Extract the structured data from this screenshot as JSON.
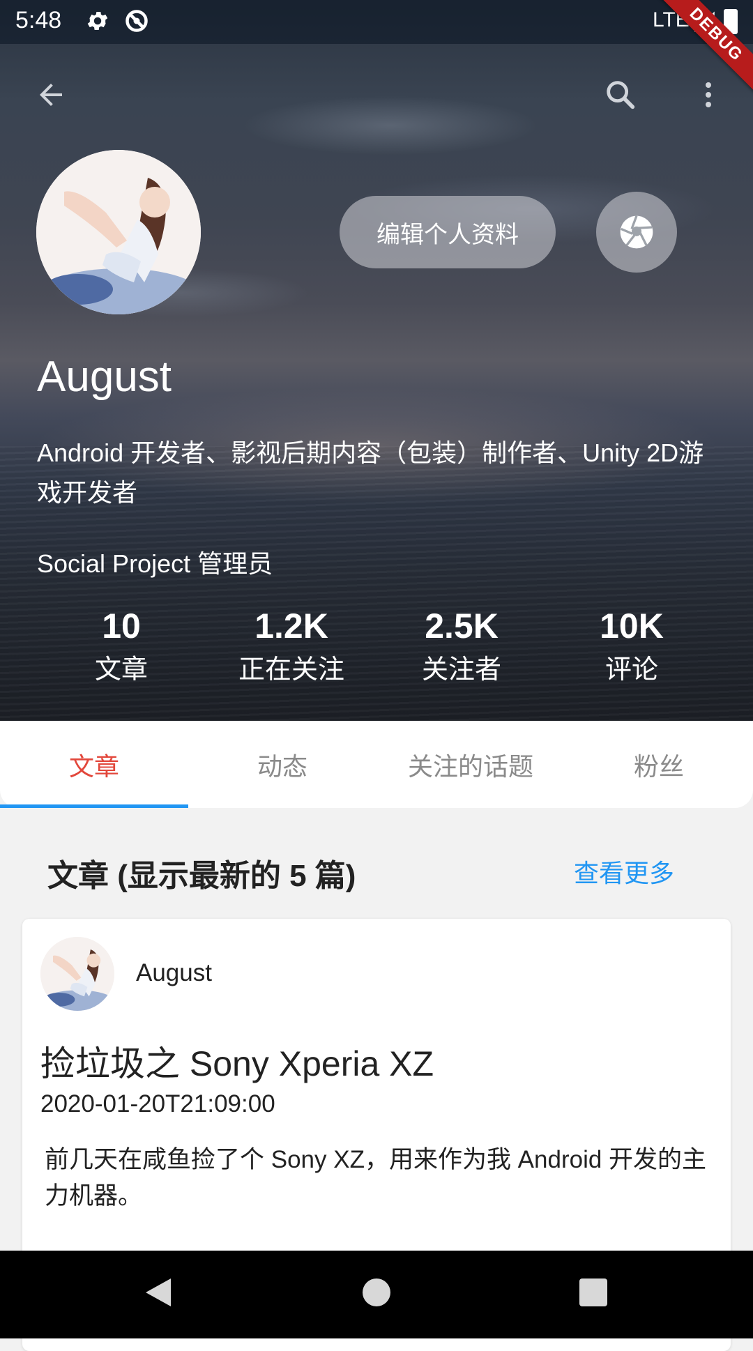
{
  "status_bar": {
    "time": "5:48",
    "network": "LTE",
    "debug_label": "DEBUG"
  },
  "toolbar": {
    "back_icon": "arrow-back-icon",
    "search_icon": "search-icon",
    "more_icon": "more-vert-icon"
  },
  "profile": {
    "edit_label": "编辑个人资料",
    "name": "August",
    "bio": "Android 开发者、影视后期内容（包装）制作者、Unity 2D游戏开发者",
    "role": "Social Project 管理员",
    "stats": [
      {
        "value": "10",
        "label": "文章"
      },
      {
        "value": "1.2K",
        "label": "正在关注"
      },
      {
        "value": "2.5K",
        "label": "关注者"
      },
      {
        "value": "10K",
        "label": "评论"
      }
    ]
  },
  "tabs": [
    {
      "label": "文章",
      "active": true
    },
    {
      "label": "动态",
      "active": false
    },
    {
      "label": "关注的话题",
      "active": false
    },
    {
      "label": "粉丝",
      "active": false
    }
  ],
  "section": {
    "title": "文章 (显示最新的 5 篇)",
    "more_label": "查看更多"
  },
  "article": {
    "author": "August",
    "title": "捡垃圾之 Sony Xperia XZ",
    "date": "2020-01-20T21:09:00",
    "excerpt": "前几天在咸鱼捡了个 Sony XZ，用来作为我 Android 开发的主力机器。"
  },
  "colors": {
    "accent_tab": "#e2473b",
    "indicator": "#2196f3",
    "link": "#2196f3"
  }
}
